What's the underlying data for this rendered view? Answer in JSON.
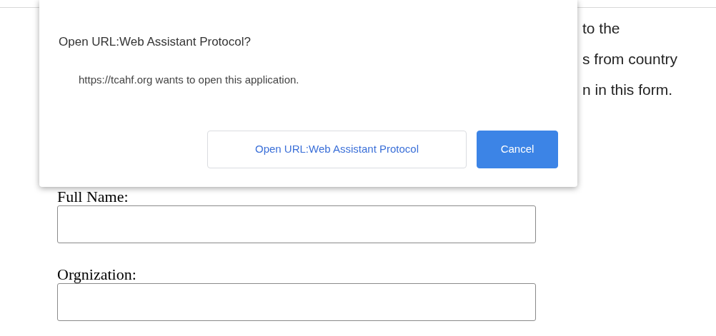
{
  "dialog": {
    "title": "Open URL:Web Assistant Protocol?",
    "message": "https://tcahf.org wants to open this application.",
    "buttons": [
      {
        "label": "Open URL:Web Assistant Protocol",
        "kind": "secondary"
      },
      {
        "label": "Cancel",
        "kind": "primary"
      }
    ]
  },
  "background_text": [
    "to the",
    "s from country",
    "n in this form."
  ],
  "form": {
    "fields": [
      {
        "label": "Full Name:"
      },
      {
        "label": "Orgnization:"
      }
    ]
  }
}
